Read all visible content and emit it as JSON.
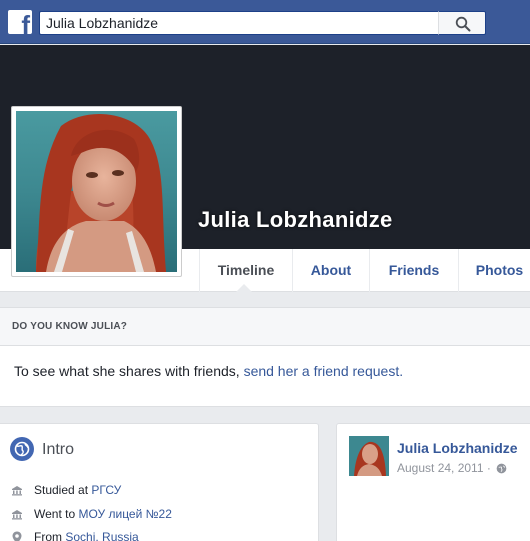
{
  "topbar": {
    "logo": "f",
    "search_value": "Julia Lobzhanidze",
    "search_icon": "search-icon"
  },
  "profile": {
    "name": "Julia Lobzhanidze"
  },
  "nav": {
    "tabs": [
      {
        "label": "Timeline",
        "active": true
      },
      {
        "label": "About",
        "active": false
      },
      {
        "label": "Friends",
        "active": false
      },
      {
        "label": "Photos",
        "active": false
      }
    ]
  },
  "know_panel": {
    "header": "DO YOU KNOW JULIA?",
    "text_prefix": "To see what she shares with friends, ",
    "link_text": "send her a friend request."
  },
  "intro": {
    "title": "Intro",
    "rows": [
      {
        "icon": "school-icon",
        "prefix": "Studied at ",
        "link": "РГСУ"
      },
      {
        "icon": "school-icon",
        "prefix": "Went to ",
        "link": "МОУ лицей №22"
      },
      {
        "icon": "location-pin-icon",
        "prefix": "From ",
        "link": "Sochi, Russia"
      }
    ]
  },
  "post": {
    "author": "Julia Lobzhanidze",
    "date": "August 24, 2011 ·",
    "privacy_icon": "globe-icon"
  },
  "colors": {
    "brand": "#3b5998",
    "link": "#365899",
    "page_bg": "#e9ebee",
    "cover": "#1d2129"
  }
}
